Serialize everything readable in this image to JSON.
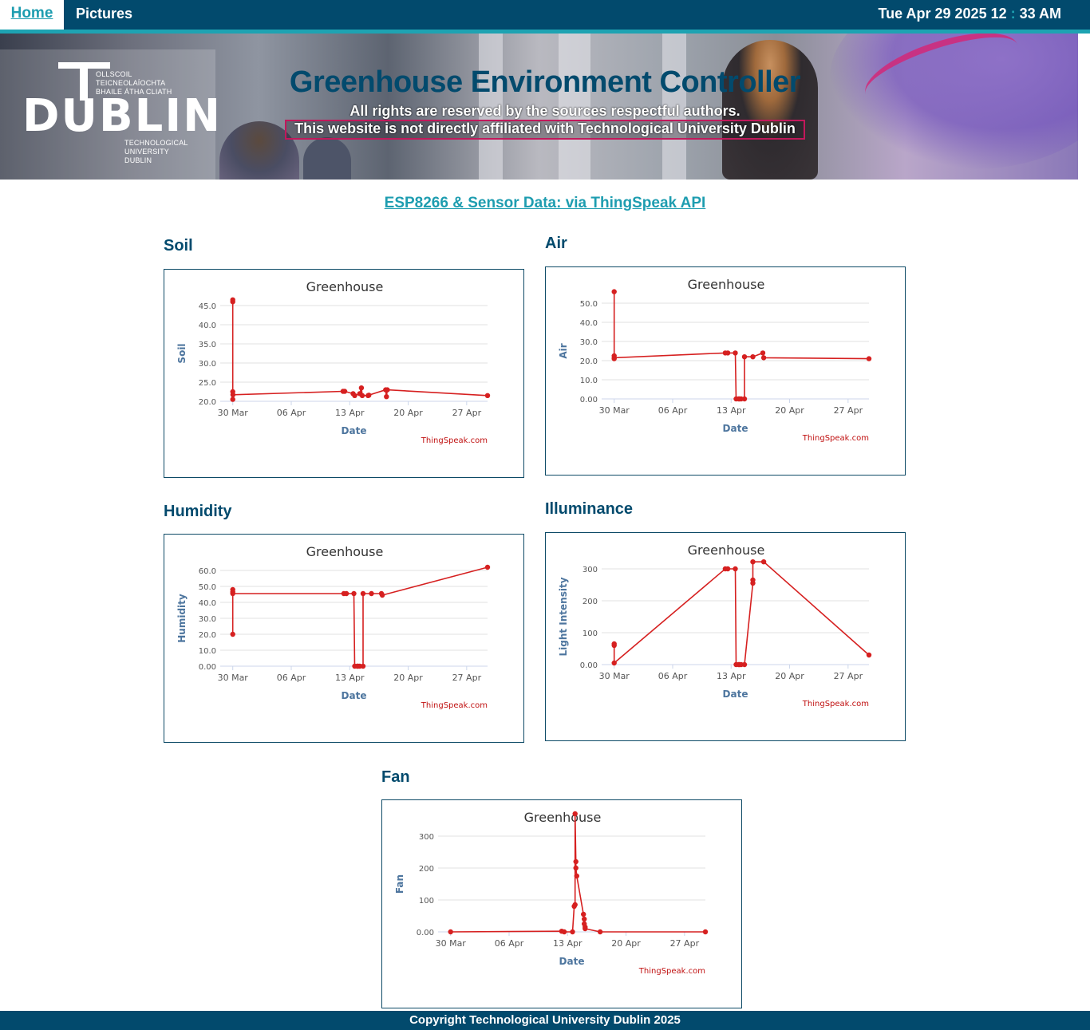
{
  "nav": {
    "home_label": "Home",
    "pictures_label": "Pictures",
    "clock_date": "Tue Apr 29 2025 12",
    "clock_sep": ":",
    "clock_time": "33 AM"
  },
  "banner": {
    "logo_irish_line1": "OLLSCOIL TEICNEOLAÍOCHTA",
    "logo_irish_line2": "BHAILE ÁTHA CLIATH",
    "logo_dublin": "DUBLIN",
    "logo_eng_line1": "TECHNOLOGICAL",
    "logo_eng_line2": "UNIVERSITY DUBLIN",
    "title": "Greenhouse Environment Controller",
    "rights": "All rights are reserved by the sources respectful authors.",
    "disclaimer": "This website is not directly affiliated with Technological University Dublin"
  },
  "subtitle": "ESP8266 & Sensor Data: via ThingSpeak API",
  "sections": {
    "soil": "Soil",
    "air": "Air",
    "humidity": "Humidity",
    "illuminance": "Illuminance",
    "fan": "Fan"
  },
  "footer": "Copyright Technological University Dublin 2025",
  "chart_data": [
    {
      "id": "soil",
      "type": "line",
      "title": "Greenhouse",
      "xlabel": "Date",
      "ylabel": "Soil",
      "credit": "ThingSpeak.com",
      "color": "#d62020",
      "x_ticks": [
        "30 Mar",
        "06 Apr",
        "13 Apr",
        "20 Apr",
        "27 Apr"
      ],
      "y_ticks": [
        "20.0",
        "25.0",
        "30.0",
        "35.0",
        "40.0",
        "45.0"
      ],
      "ylim": [
        20,
        45
      ],
      "xlim": [
        28.5,
        30
      ],
      "series": [
        {
          "x": [
            0,
            0,
            0,
            0,
            0.02,
            13.2,
            13.4,
            14.4,
            14.6,
            15.2,
            15.4,
            15.5,
            16.2,
            16.3,
            18.3,
            18.4,
            18.5,
            30.5
          ],
          "y": [
            46.5,
            46.0,
            20.5,
            22.5,
            21.7,
            22.6,
            22.6,
            22.0,
            21.5,
            22.0,
            23.5,
            21.5,
            21.5,
            21.6,
            23.0,
            21.2,
            23.0,
            21.5
          ]
        }
      ]
    },
    {
      "id": "air",
      "type": "line",
      "title": "Greenhouse",
      "xlabel": "Date",
      "ylabel": "Air",
      "credit": "ThingSpeak.com",
      "color": "#d62020",
      "x_ticks": [
        "30 Mar",
        "06 Apr",
        "13 Apr",
        "20 Apr",
        "27 Apr"
      ],
      "y_ticks": [
        "0.00",
        "10.0",
        "20.0",
        "30.0",
        "40.0",
        "50.0"
      ],
      "ylim": [
        0,
        50
      ],
      "series": [
        {
          "x": [
            0,
            0,
            0,
            0,
            13.3,
            13.6,
            14.5,
            14.6,
            14.9,
            15.0,
            15.2,
            15.6,
            15.6,
            16.6,
            17.8,
            17.9,
            30.5
          ],
          "y": [
            56.0,
            21.0,
            22.5,
            21.5,
            24.0,
            24.0,
            24.0,
            0,
            0,
            0,
            0,
            0,
            22.0,
            22.0,
            24.0,
            21.5,
            21.0
          ]
        }
      ]
    },
    {
      "id": "humidity",
      "type": "line",
      "title": "Greenhouse",
      "xlabel": "Date",
      "ylabel": "Humidity",
      "credit": "ThingSpeak.com",
      "color": "#d62020",
      "x_ticks": [
        "30 Mar",
        "06 Apr",
        "13 Apr",
        "20 Apr",
        "27 Apr"
      ],
      "y_ticks": [
        "0.00",
        "10.0",
        "20.0",
        "30.0",
        "40.0",
        "50.0",
        "60.0"
      ],
      "ylim": [
        0,
        60
      ],
      "series": [
        {
          "x": [
            0,
            0,
            0,
            0,
            13.3,
            13.6,
            14.5,
            14.6,
            14.9,
            15.0,
            15.2,
            15.6,
            15.6,
            16.6,
            17.8,
            17.9,
            30.5
          ],
          "y": [
            20.0,
            48.0,
            46.5,
            45.5,
            45.5,
            45.5,
            45.5,
            0,
            0,
            0,
            0,
            0,
            45.5,
            45.5,
            45.5,
            44.5,
            62.0
          ]
        }
      ]
    },
    {
      "id": "illuminance",
      "type": "line",
      "title": "Greenhouse",
      "xlabel": "Date",
      "ylabel": "Light Intensity",
      "credit": "ThingSpeak.com",
      "color": "#d62020",
      "x_ticks": [
        "30 Mar",
        "06 Apr",
        "13 Apr",
        "20 Apr",
        "27 Apr"
      ],
      "y_ticks": [
        "0.00",
        "100",
        "200",
        "300"
      ],
      "ylim": [
        0,
        300
      ],
      "series": [
        {
          "x": [
            0,
            0,
            0,
            13.3,
            13.6,
            14.5,
            14.6,
            14.9,
            15.0,
            15.2,
            15.6,
            16.6,
            16.6,
            16.6,
            17.9,
            30.5
          ],
          "y": [
            65,
            60,
            5,
            300,
            300,
            300,
            0,
            0,
            0,
            0,
            0,
            255,
            265,
            322,
            322,
            30
          ]
        }
      ]
    },
    {
      "id": "fan",
      "type": "line",
      "title": "Greenhouse",
      "xlabel": "Date",
      "ylabel": "Fan",
      "credit": "ThingSpeak.com",
      "color": "#d62020",
      "x_ticks": [
        "30 Mar",
        "06 Apr",
        "13 Apr",
        "20 Apr",
        "27 Apr"
      ],
      "y_ticks": [
        "0.00",
        "100",
        "200",
        "300"
      ],
      "ylim": [
        0,
        300
      ],
      "series": [
        {
          "x": [
            0,
            13.3,
            13.6,
            14.6,
            14.8,
            14.9,
            14.9,
            15.0,
            15.0,
            15.1,
            15.9,
            16.0,
            16.0,
            16.1,
            16.1,
            17.9,
            30.5
          ],
          "y": [
            0,
            2,
            0,
            0,
            80,
            85,
            370,
            220,
            200,
            175,
            55,
            40,
            25,
            15,
            10,
            0,
            0
          ]
        }
      ]
    }
  ]
}
